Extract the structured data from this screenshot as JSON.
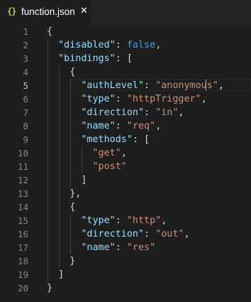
{
  "tab": {
    "icon_glyph": "{}",
    "icon_name": "json-braces-icon",
    "label": "function.json",
    "close_glyph": "✕",
    "close_icon": "close-icon"
  },
  "editor": {
    "active_line": 5,
    "lines": [
      {
        "n": "1",
        "segments": [
          {
            "t": "{",
            "c": "p"
          }
        ]
      },
      {
        "n": "2",
        "segments": [
          {
            "t": "  ",
            "c": "p"
          },
          {
            "t": "\"disabled\"",
            "c": "k"
          },
          {
            "t": ": ",
            "c": "p"
          },
          {
            "t": "false",
            "c": "b"
          },
          {
            "t": ",",
            "c": "p"
          }
        ]
      },
      {
        "n": "3",
        "segments": [
          {
            "t": "  ",
            "c": "p"
          },
          {
            "t": "\"bindings\"",
            "c": "k"
          },
          {
            "t": ": [",
            "c": "p"
          }
        ]
      },
      {
        "n": "4",
        "segments": [
          {
            "t": "    {",
            "c": "p"
          }
        ]
      },
      {
        "n": "5",
        "segments": [
          {
            "t": "      ",
            "c": "p"
          },
          {
            "t": "\"authLevel\"",
            "c": "k"
          },
          {
            "t": ": ",
            "c": "p"
          },
          {
            "t": "\"anonymous\"",
            "c": "s"
          },
          {
            "t": ",",
            "c": "p"
          }
        ]
      },
      {
        "n": "6",
        "segments": [
          {
            "t": "      ",
            "c": "p"
          },
          {
            "t": "\"type\"",
            "c": "k"
          },
          {
            "t": ": ",
            "c": "p"
          },
          {
            "t": "\"httpTrigger\"",
            "c": "s"
          },
          {
            "t": ",",
            "c": "p"
          }
        ]
      },
      {
        "n": "7",
        "segments": [
          {
            "t": "      ",
            "c": "p"
          },
          {
            "t": "\"direction\"",
            "c": "k"
          },
          {
            "t": ": ",
            "c": "p"
          },
          {
            "t": "\"in\"",
            "c": "s"
          },
          {
            "t": ",",
            "c": "p"
          }
        ]
      },
      {
        "n": "8",
        "segments": [
          {
            "t": "      ",
            "c": "p"
          },
          {
            "t": "\"name\"",
            "c": "k"
          },
          {
            "t": ": ",
            "c": "p"
          },
          {
            "t": "\"req\"",
            "c": "s"
          },
          {
            "t": ",",
            "c": "p"
          }
        ]
      },
      {
        "n": "9",
        "segments": [
          {
            "t": "      ",
            "c": "p"
          },
          {
            "t": "\"methods\"",
            "c": "k"
          },
          {
            "t": ": [",
            "c": "p"
          }
        ]
      },
      {
        "n": "10",
        "segments": [
          {
            "t": "        ",
            "c": "p"
          },
          {
            "t": "\"get\"",
            "c": "s"
          },
          {
            "t": ",",
            "c": "p"
          }
        ]
      },
      {
        "n": "11",
        "segments": [
          {
            "t": "        ",
            "c": "p"
          },
          {
            "t": "\"post\"",
            "c": "s"
          }
        ]
      },
      {
        "n": "12",
        "segments": [
          {
            "t": "      ]",
            "c": "p"
          }
        ]
      },
      {
        "n": "13",
        "segments": [
          {
            "t": "    },",
            "c": "p"
          }
        ]
      },
      {
        "n": "14",
        "segments": [
          {
            "t": "    {",
            "c": "p"
          }
        ]
      },
      {
        "n": "15",
        "segments": [
          {
            "t": "      ",
            "c": "p"
          },
          {
            "t": "\"type\"",
            "c": "k"
          },
          {
            "t": ": ",
            "c": "p"
          },
          {
            "t": "\"http\"",
            "c": "s"
          },
          {
            "t": ",",
            "c": "p"
          }
        ]
      },
      {
        "n": "16",
        "segments": [
          {
            "t": "      ",
            "c": "p"
          },
          {
            "t": "\"direction\"",
            "c": "k"
          },
          {
            "t": ": ",
            "c": "p"
          },
          {
            "t": "\"out\"",
            "c": "s"
          },
          {
            "t": ",",
            "c": "p"
          }
        ]
      },
      {
        "n": "17",
        "segments": [
          {
            "t": "      ",
            "c": "p"
          },
          {
            "t": "\"name\"",
            "c": "k"
          },
          {
            "t": ": ",
            "c": "p"
          },
          {
            "t": "\"res\"",
            "c": "s"
          }
        ]
      },
      {
        "n": "18",
        "segments": [
          {
            "t": "    }",
            "c": "p"
          }
        ]
      },
      {
        "n": "19",
        "segments": [
          {
            "t": "  ]",
            "c": "p"
          }
        ]
      },
      {
        "n": "20",
        "segments": [
          {
            "t": "}",
            "c": "p"
          }
        ]
      }
    ]
  },
  "colors": {
    "background": "#1e1e1e",
    "tabbar": "#252526",
    "key": "#9cdcfe",
    "string": "#ce9178",
    "boolean": "#569cd6",
    "punctuation": "#d4d4d4",
    "line_number": "#858585",
    "braces_icon": "#cbcb41"
  }
}
